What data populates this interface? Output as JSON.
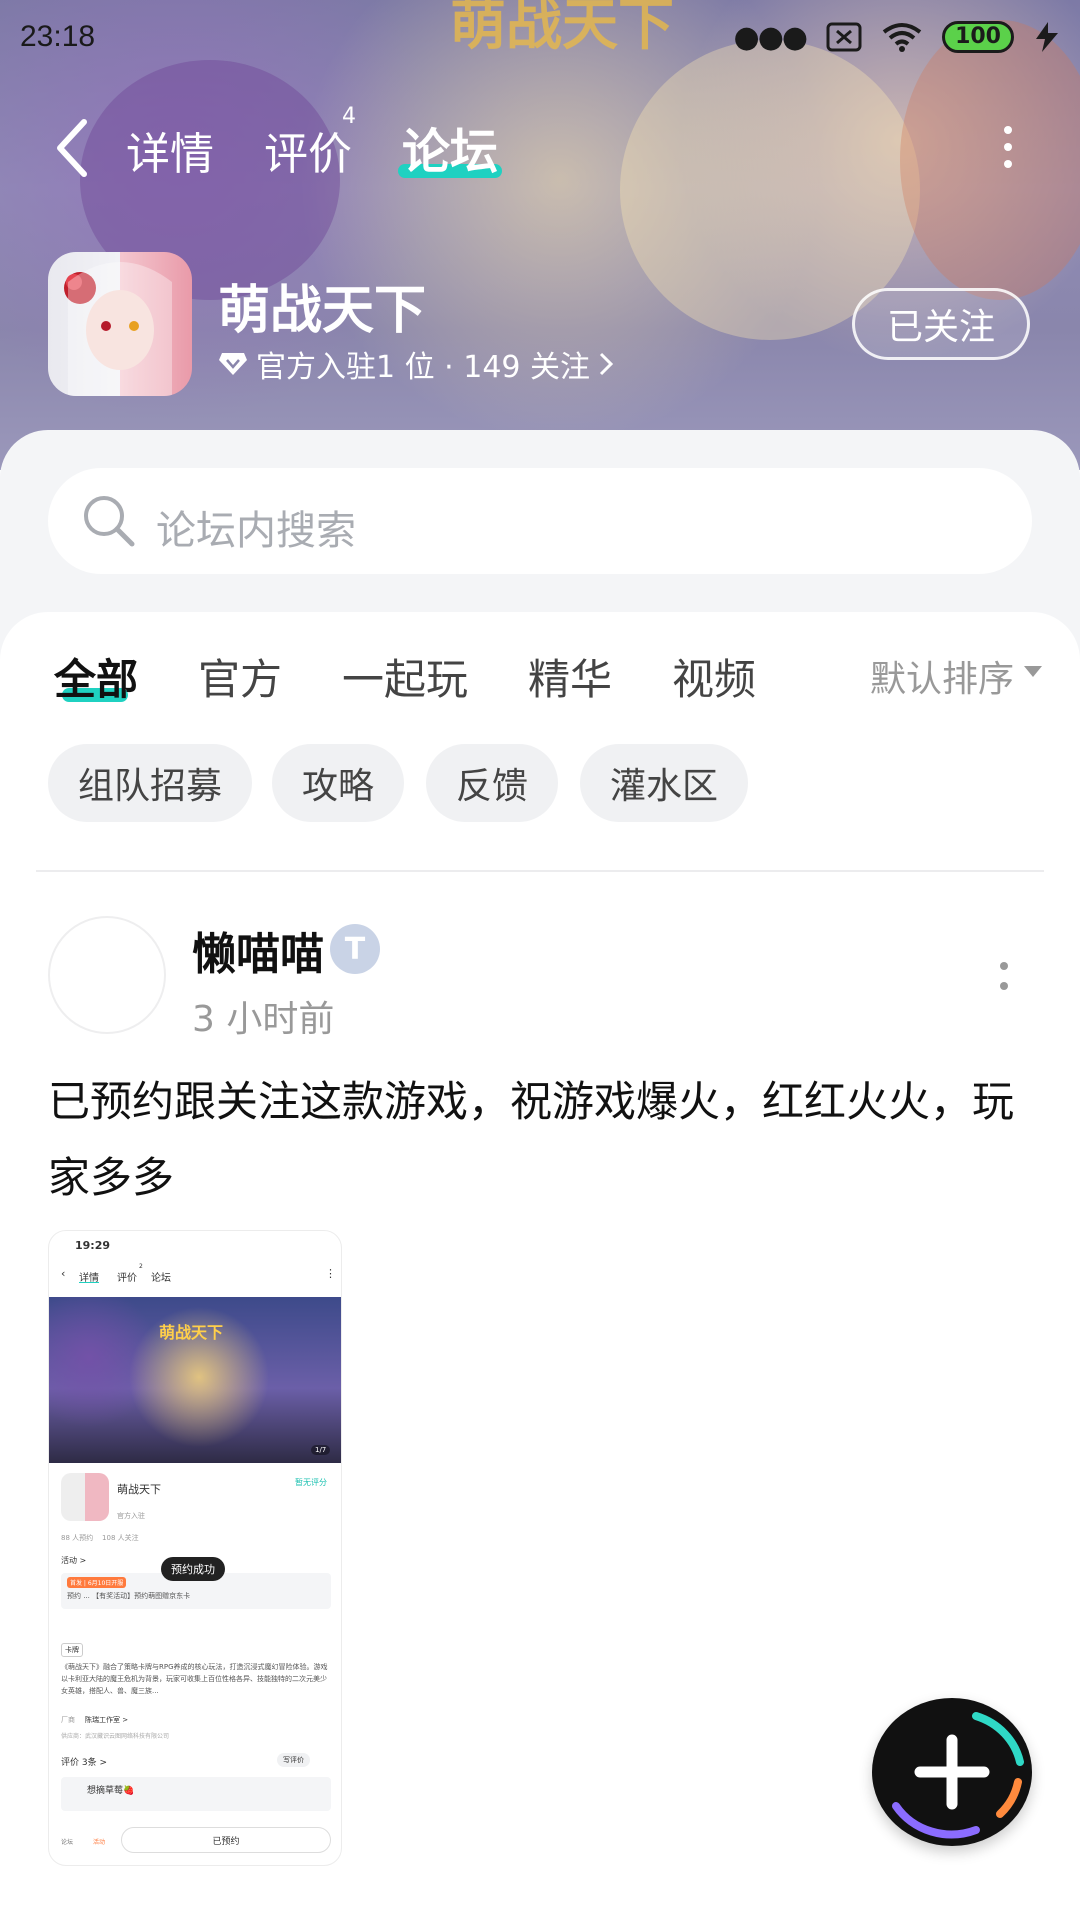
{
  "status_bar": {
    "time": "23:18",
    "battery": "100"
  },
  "nav": {
    "tabs": [
      {
        "label": "详情"
      },
      {
        "label": "评价",
        "badge": "4"
      },
      {
        "label": "论坛",
        "active": true
      }
    ]
  },
  "game": {
    "title": "萌战天下",
    "meta": "官方入驻1 位 · 149 关注",
    "follow_label": "已关注"
  },
  "search": {
    "placeholder": "论坛内搜索"
  },
  "feed_tabs": [
    {
      "label": "全部",
      "active": true
    },
    {
      "label": "官方"
    },
    {
      "label": "一起玩"
    },
    {
      "label": "精华"
    },
    {
      "label": "视频"
    }
  ],
  "sort_label": "默认排序",
  "chips": [
    "组队招募",
    "攻略",
    "反馈",
    "灌水区"
  ],
  "post": {
    "author": "懒喵喵",
    "time": "3 小时前",
    "text": "已预约跟关注这款游戏，祝游戏爆火，红红火火，玩家多多",
    "image": {
      "time": "19:29",
      "tabs": [
        "详情",
        "评价",
        "论坛"
      ],
      "tab_badge": "2",
      "banner_logo": "萌战天下",
      "pager": "1/7",
      "game_name": "萌战天下",
      "no_rating": "暂无评分",
      "official": "官方入驻",
      "stats": "88 人预约    108 人关注",
      "activity": "活动 >",
      "activity_tag": "首发 | 6月10日开服",
      "activity_text": "预约 ... 【有奖活动】预约萌图赠京东卡",
      "toast": "预约成功",
      "tag": "卡牌",
      "desc": "《萌战天下》融合了策略卡牌与RPG养成的核心玩法，打造沉浸式魔幻冒险体验。游戏以卡利亚大陆的魔王危机为背景，玩家可收集上百位性格各异、技能独特的二次元美少女英雄，搭配人、兽、魔三族...",
      "maker_label": "厂商",
      "maker": "陈瑞工作室 >",
      "publisher": "供应商：武汉藏识云图网络科技有限公司",
      "reviews": "评价 3条 >",
      "write_review": "写评价",
      "reviewer": "想摘草莓🍓",
      "reserved": "已预约",
      "bottom_left": "论坛",
      "bottom_mid": "活动"
    }
  }
}
